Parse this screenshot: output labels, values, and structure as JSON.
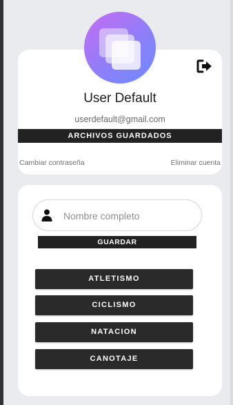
{
  "profile": {
    "name": "User Default",
    "email": "userdefault@gmail.com",
    "saved_files_label": "ARCHIVOS GUARDADOS",
    "change_password_label": "Cambiar contraseña",
    "delete_account_label": "Eliminar cuenta",
    "avatar_icon": "stacked-squares-icon",
    "logout_icon": "logout-icon"
  },
  "form": {
    "name_placeholder": "Nombre completo",
    "name_value": "",
    "save_label": "GUARDAR",
    "user_icon": "user-icon"
  },
  "sports": [
    {
      "label": "ATLETISMO"
    },
    {
      "label": "CICLISMO"
    },
    {
      "label": "NATACION"
    },
    {
      "label": "CANOTAJE"
    }
  ],
  "colors": {
    "background": "#e9ebee",
    "card": "#ffffff",
    "button": "#222222",
    "avatar_gradient_start": "#c86cf4",
    "avatar_gradient_end": "#6d8cff"
  }
}
